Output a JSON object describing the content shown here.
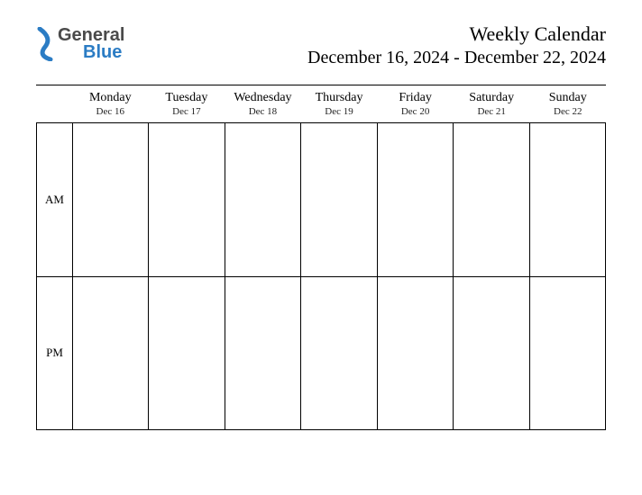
{
  "logo": {
    "word1": "General",
    "word2": "Blue",
    "color_general": "#4a4a4a",
    "color_blue": "#2b7cc4"
  },
  "header": {
    "title": "Weekly Calendar",
    "date_range": "December 16, 2024 - December 22, 2024"
  },
  "rows": [
    {
      "label": "AM"
    },
    {
      "label": "PM"
    }
  ],
  "days": [
    {
      "name": "Monday",
      "date": "Dec 16"
    },
    {
      "name": "Tuesday",
      "date": "Dec 17"
    },
    {
      "name": "Wednesday",
      "date": "Dec 18"
    },
    {
      "name": "Thursday",
      "date": "Dec 19"
    },
    {
      "name": "Friday",
      "date": "Dec 20"
    },
    {
      "name": "Saturday",
      "date": "Dec 21"
    },
    {
      "name": "Sunday",
      "date": "Dec 22"
    }
  ]
}
